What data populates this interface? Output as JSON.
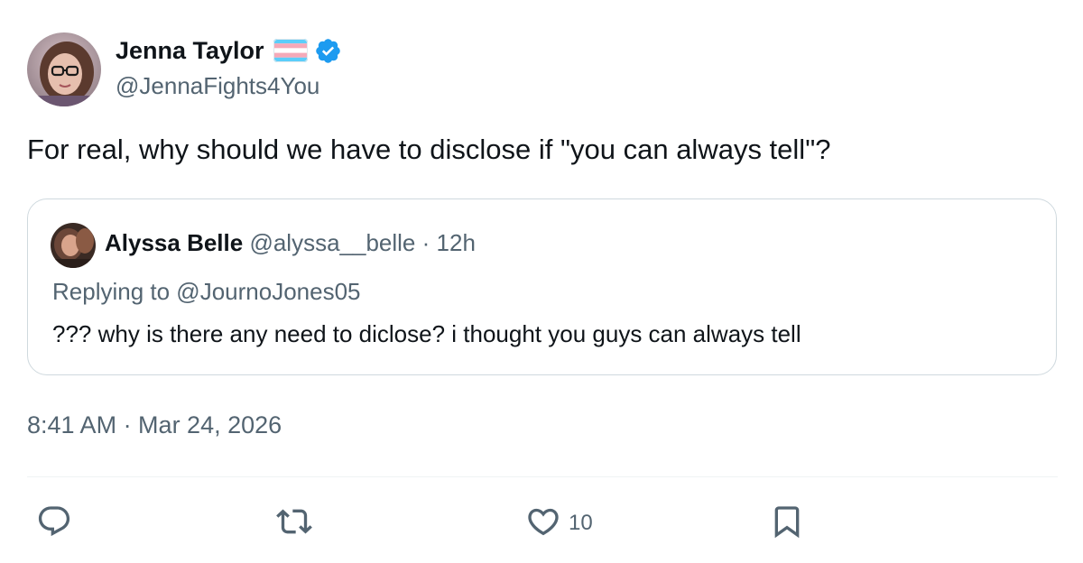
{
  "tweet": {
    "author": {
      "display_name": "Jenna Taylor",
      "handle": "@JennaFights4You",
      "flag_icon": "transgender-flag-icon",
      "verified_icon": "verified-badge-icon"
    },
    "text": "For real, why should we have to disclose if \"you can always tell\"?",
    "quoted": {
      "display_name": "Alyssa Belle",
      "handle": "@alyssa__belle",
      "separator": "·",
      "time": "12h",
      "replying_to": "Replying to @JournoJones05",
      "text": "??? why is there any need to diclose? i thought you guys can always tell"
    },
    "timestamp": "8:41 AM · Mar 24, 2026",
    "actions": {
      "reply_icon": "reply-icon",
      "retweet_icon": "retweet-icon",
      "like_icon": "heart-icon",
      "like_count": "10",
      "bookmark_icon": "bookmark-icon"
    }
  },
  "colors": {
    "text_primary": "#0f1419",
    "text_secondary": "#536471",
    "border": "#cfd9de",
    "verified_blue": "#1d9bf0",
    "flag_blue": "#5bcefa",
    "flag_pink": "#f5a9b8",
    "flag_white": "#ffffff"
  }
}
